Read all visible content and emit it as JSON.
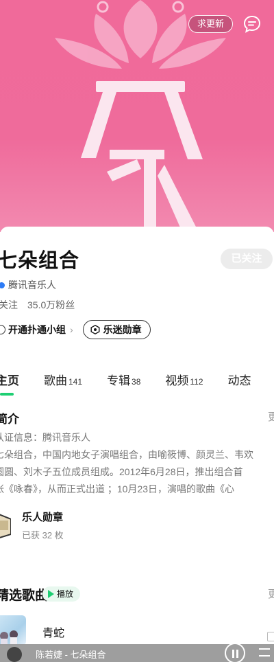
{
  "header": {
    "update_button": "求更新",
    "chat_icon": "chat-bubble-icon"
  },
  "artist": {
    "name": "七朵组合",
    "follow_button": "已关注",
    "verified_by": "腾讯音乐人",
    "follow_label": "关注",
    "fans": "35.0万粉丝",
    "group_link": "开通扑通小组",
    "medal_pill": "乐迷勋章"
  },
  "tabs": [
    {
      "label": "主页",
      "count": ""
    },
    {
      "label": "歌曲",
      "count": "141"
    },
    {
      "label": "专辑",
      "count": "38"
    },
    {
      "label": "视频",
      "count": "112"
    },
    {
      "label": "动态",
      "count": ""
    }
  ],
  "intro": {
    "title": "简介",
    "more": "更",
    "lines": [
      "认证信息：腾讯音乐人",
      "七朵组合，中国内地女子演唱组合，由喻筱博、颜灵兰、韦欢",
      "圆圆、刘木子五位成员组成。2012年6月28日，推出组合首",
      "张《咏春》，从而正式出道 ；10月23日，演唱的歌曲《心"
    ]
  },
  "badge": {
    "title": "乐人勋章",
    "subtitle": "已获 32 枚"
  },
  "songs": {
    "title": "精选歌曲",
    "play_label": "播放",
    "more": "更",
    "items": [
      {
        "title": "青蛇"
      }
    ]
  },
  "player": {
    "text": "陈若婕 - 七朵组合"
  },
  "colors": {
    "hero_pink": "#ef6b9b",
    "accent_green": "#1ecf73",
    "verify_blue": "#2d7cf6"
  }
}
